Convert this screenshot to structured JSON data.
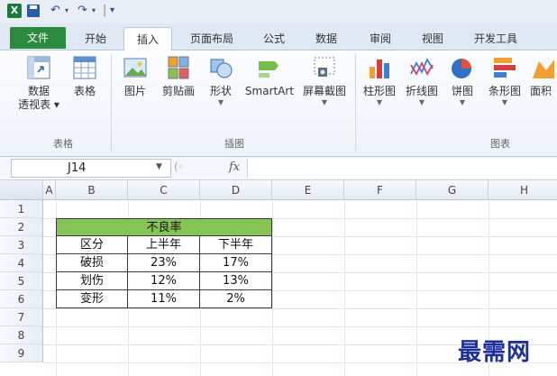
{
  "tabs": [
    "文件",
    "开始",
    "插入",
    "页面布局",
    "公式",
    "数据",
    "审阅",
    "视图",
    "开发工具"
  ],
  "active_tab": "插入",
  "ribbon": {
    "tables_group": {
      "label": "表格",
      "pivot_label": "数据",
      "pivot_label2": "透视表 ▾",
      "table_label": "表格"
    },
    "illustrations_group": {
      "label": "插图",
      "picture_label": "图片",
      "clipart_label": "剪贴画",
      "shapes_label": "形状",
      "smartart_label": "SmartArt",
      "screenshot_label": "屏幕截图"
    },
    "charts_group": {
      "label": "图表",
      "column_label": "柱形图",
      "line_label": "折线图",
      "pie_label": "饼图",
      "bar_label": "条形图",
      "area_label": "面积"
    }
  },
  "formula_bar": {
    "name_box": "J14",
    "fx_label": "fx",
    "value": ""
  },
  "columns": [
    "A",
    "B",
    "C",
    "D",
    "E",
    "F",
    "G",
    "H"
  ],
  "rows": [
    "1",
    "2",
    "3",
    "4",
    "5",
    "6",
    "7",
    "8",
    "9"
  ],
  "table": {
    "title": "不良率",
    "headers": [
      "区分",
      "上半年",
      "下半年"
    ],
    "rows": [
      [
        "破损",
        "23%",
        "17%"
      ],
      [
        "划伤",
        "12%",
        "13%"
      ],
      [
        "变形",
        "11%",
        "2%"
      ]
    ]
  },
  "colors": {
    "header_fill": "#86c456",
    "file_tab": "#2a8a3e"
  },
  "watermark": "最需网"
}
